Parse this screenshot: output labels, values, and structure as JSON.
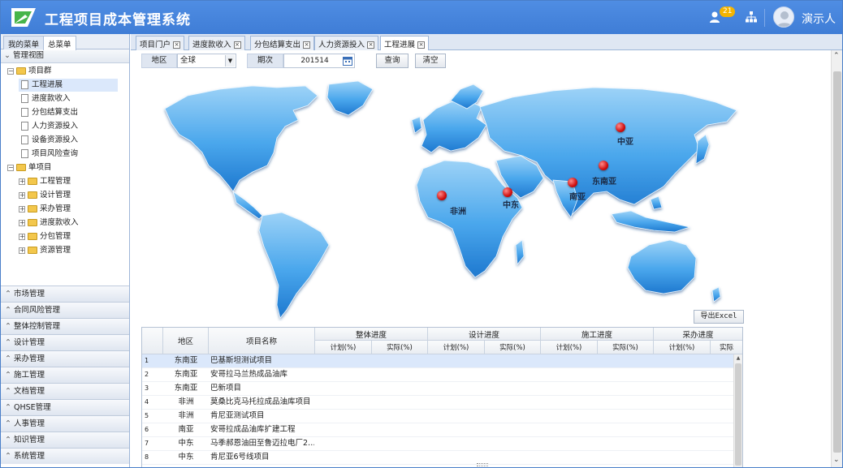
{
  "app": {
    "title": "工程项目成本管理系统",
    "notification_count": "21",
    "user_name": "演示人"
  },
  "left_panel": {
    "tabs": [
      "我的菜单",
      "总菜单"
    ],
    "section_title": "管理视图",
    "tree": [
      {
        "label": "项目群",
        "type": "folder",
        "expander": "⊟"
      },
      {
        "label": "工程进展",
        "type": "doc"
      },
      {
        "label": "进度款收入",
        "type": "doc"
      },
      {
        "label": "分包结算支出",
        "type": "doc"
      },
      {
        "label": "人力资源投入",
        "type": "doc"
      },
      {
        "label": "设备资源投入",
        "type": "doc"
      },
      {
        "label": "项目风险查询",
        "type": "doc"
      },
      {
        "label": "单项目",
        "type": "folder",
        "expander": "⊟"
      },
      {
        "label": "工程管理",
        "type": "folder",
        "expander": "⊞"
      },
      {
        "label": "设计管理",
        "type": "folder",
        "expander": "⊞"
      },
      {
        "label": "采办管理",
        "type": "folder",
        "expander": "⊞"
      },
      {
        "label": "进度款收入",
        "type": "folder",
        "expander": "⊞"
      },
      {
        "label": "分包管理",
        "type": "folder",
        "expander": "⊞"
      },
      {
        "label": "资源管理",
        "type": "folder",
        "expander": "⊞"
      }
    ],
    "accordion": [
      "市场管理",
      "合同风险管理",
      "整体控制管理",
      "设计管理",
      "采办管理",
      "施工管理",
      "文档管理",
      "QHSE管理",
      "人事管理",
      "知识管理",
      "系统管理"
    ]
  },
  "tabs": [
    {
      "label": "项目门户"
    },
    {
      "label": "进度款收入"
    },
    {
      "label": "分包结算支出"
    },
    {
      "label": "人力资源投入"
    },
    {
      "label": "工程进展"
    }
  ],
  "filters": {
    "region_label": "地区",
    "region_value": "全球",
    "period_label": "期次",
    "period_value": "201514",
    "query_label": "查询",
    "clear_label": "清空"
  },
  "map": {
    "markers": [
      {
        "label": "中亚"
      },
      {
        "label": "东南亚"
      },
      {
        "label": "南亚"
      },
      {
        "label": "中东"
      },
      {
        "label": "非洲"
      }
    ],
    "export_label": "导出Excel"
  },
  "table": {
    "headers": {
      "region": "地区",
      "name": "项目名称",
      "groups": [
        "整体进度",
        "设计进度",
        "施工进度",
        "采办进度"
      ],
      "plan": "计划(%)",
      "actual": "实际(%)",
      "actual_cut": "实际"
    },
    "rows": [
      {
        "no": "1",
        "region": "东南亚",
        "name": "巴基斯坦测试项目"
      },
      {
        "no": "2",
        "region": "东南亚",
        "name": "安哥拉马兰热成品油库"
      },
      {
        "no": "3",
        "region": "东南亚",
        "name": "巴新项目"
      },
      {
        "no": "4",
        "region": "非洲",
        "name": "莫桑比克马托拉成品油库项目"
      },
      {
        "no": "5",
        "region": "非洲",
        "name": "肯尼亚测试项目"
      },
      {
        "no": "6",
        "region": "南亚",
        "name": "安哥拉成品油库扩建工程"
      },
      {
        "no": "7",
        "region": "中东",
        "name": "马季郝恩油田至鲁迈拉电厂2…"
      },
      {
        "no": "8",
        "region": "中东",
        "name": "肯尼亚6号线项目"
      }
    ]
  }
}
